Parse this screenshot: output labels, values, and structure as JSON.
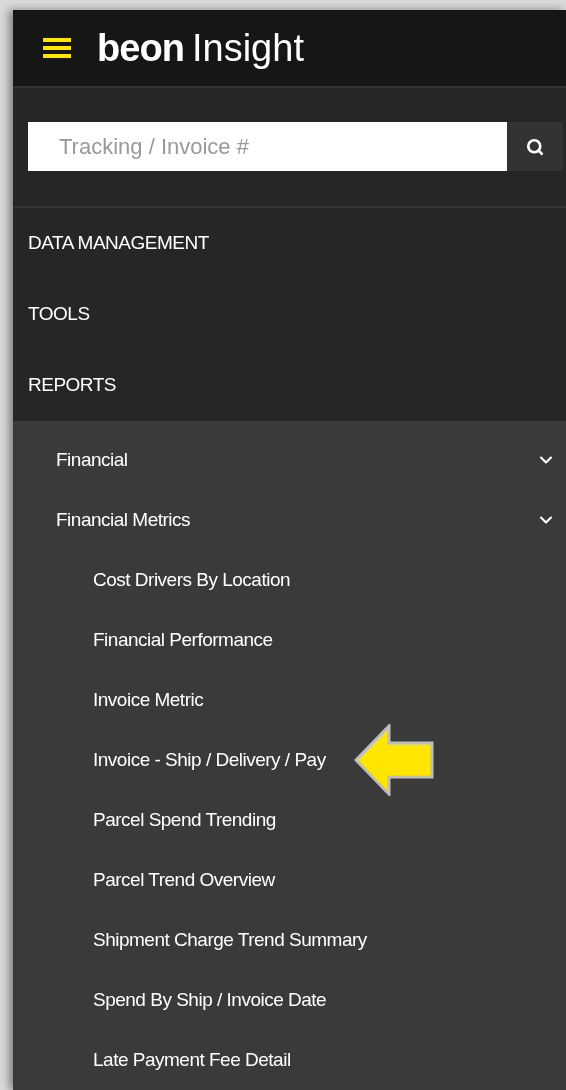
{
  "header": {
    "logo_bold": "beon",
    "logo_light": "Insight"
  },
  "search": {
    "placeholder": "Tracking / Invoice #"
  },
  "menu": [
    {
      "label": "DATA MANAGEMENT"
    },
    {
      "label": "TOOLS"
    },
    {
      "label": "REPORTS",
      "children": [
        {
          "label": "Financial",
          "expanded": true
        },
        {
          "label": "Financial Metrics",
          "expanded": true,
          "children": [
            {
              "label": "Cost Drivers By Location",
              "annotated": false
            },
            {
              "label": "Financial Performance",
              "annotated": false
            },
            {
              "label": "Invoice Metric",
              "annotated": false
            },
            {
              "label": "Invoice - Ship / Delivery / Pay",
              "annotated": true
            },
            {
              "label": "Parcel Spend Trending",
              "annotated": false
            },
            {
              "label": "Parcel Trend Overview",
              "annotated": false
            },
            {
              "label": "Shipment Charge Trend Summary",
              "annotated": false
            },
            {
              "label": "Spend By Ship / Invoice Date",
              "annotated": false
            },
            {
              "label": "Late Payment Fee Detail",
              "annotated": false
            }
          ]
        }
      ]
    }
  ]
}
